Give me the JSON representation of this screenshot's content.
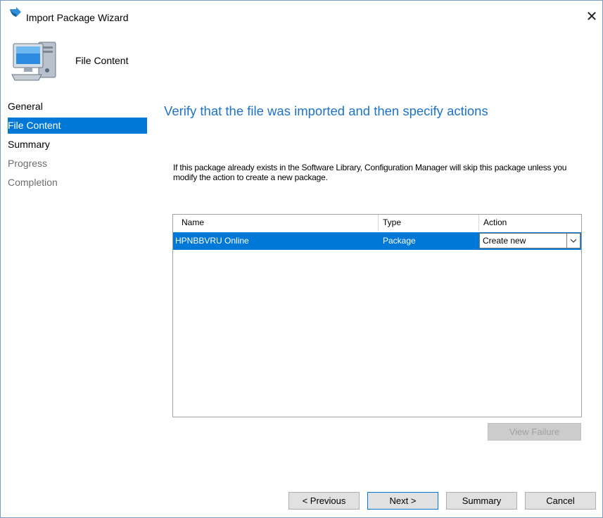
{
  "window": {
    "title": "Import Package Wizard",
    "close_glyph": "✕"
  },
  "header": {
    "title": "File Content",
    "icon": "computer-icon"
  },
  "nav": {
    "items": [
      {
        "label": "General",
        "state": "normal"
      },
      {
        "label": "File Content",
        "state": "active"
      },
      {
        "label": "Summary",
        "state": "normal"
      },
      {
        "label": "Progress",
        "state": "disabled"
      },
      {
        "label": "Completion",
        "state": "disabled"
      }
    ]
  },
  "main": {
    "heading": "Verify that the file was imported and then specify actions",
    "info": "If this package already exists in the Software Library, Configuration Manager will skip this package unless you modify the action to create a new package."
  },
  "grid": {
    "columns": [
      "Name",
      "Type",
      "Action"
    ],
    "rows": [
      {
        "name": "HPNBBVRU Online",
        "type": "Package",
        "action": "Create new"
      }
    ],
    "view_failure_label": "View Failure"
  },
  "footer": {
    "previous_label": "< Previous",
    "next_label": "Next >",
    "summary_label": "Summary",
    "cancel_label": "Cancel"
  },
  "colors": {
    "accent": "#0078d7",
    "heading": "#1e73c8"
  }
}
